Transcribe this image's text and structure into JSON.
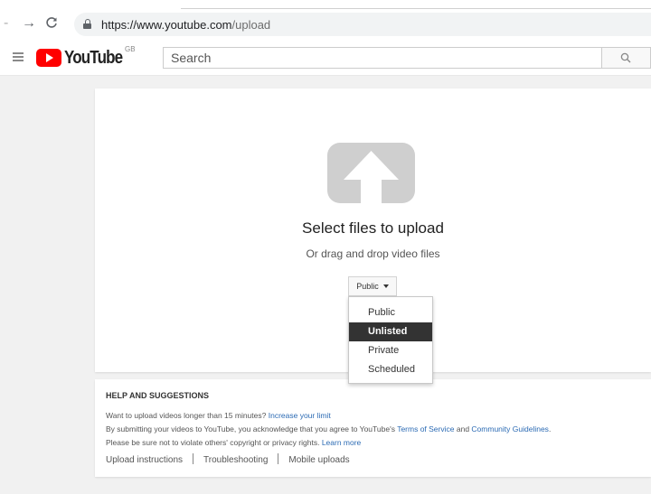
{
  "browser": {
    "url_host": "https://www.youtube.com",
    "url_path": "/upload"
  },
  "header": {
    "logo_text": "YouTube",
    "region": "GB",
    "search_placeholder": "Search"
  },
  "upload": {
    "title": "Select files to upload",
    "subtitle": "Or drag and drop video files",
    "privacy_value": "Public",
    "privacy_options": [
      "Public",
      "Unlisted",
      "Private",
      "Scheduled"
    ],
    "highlighted_option": "Unlisted"
  },
  "help": {
    "title": "HELP AND SUGGESTIONS",
    "line1_text": "Want to upload videos longer than 15 minutes?",
    "line1_link": "Increase your limit",
    "line2_text": "By submitting your videos to YouTube, you acknowledge that you agree to YouTube's",
    "line2_link1": "Terms of Service",
    "line2_and": "and",
    "line2_link2": "Community Guidelines",
    "line2_end": ".",
    "line3_text": "Please be sure not to violate others' copyright or privacy rights.",
    "line3_link": "Learn more",
    "links": [
      "Upload instructions",
      "Troubleshooting",
      "Mobile uploads"
    ]
  },
  "colors": {
    "brand_red": "#ff0000",
    "link_blue": "#2c6bb4",
    "selected_bg": "#333333"
  }
}
